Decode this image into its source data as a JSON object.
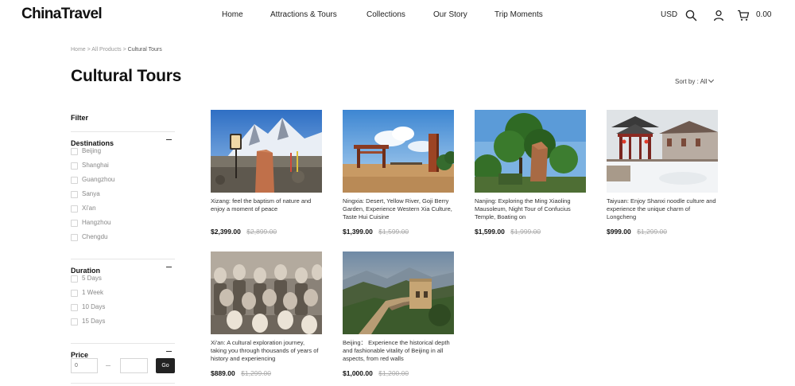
{
  "brand": {
    "logo": "ChinaTravel"
  },
  "nav": [
    {
      "label": "Home"
    },
    {
      "label": "Attractions & Tours"
    },
    {
      "label": "Collections"
    },
    {
      "label": "Our Story"
    },
    {
      "label": "Trip Moments"
    }
  ],
  "header": {
    "currency": "USD",
    "cart_total": "0.00",
    "icons": [
      "search-icon",
      "user-icon",
      "cart-icon"
    ]
  },
  "breadcrumb": {
    "home": "Home",
    "all_products": "All Products",
    "current": "Cultural Tours",
    "separator": ">"
  },
  "page": {
    "title": "Cultural Tours",
    "sort_label": "Sort by : All"
  },
  "filter": {
    "title": "Filter",
    "destinations": {
      "label": "Destinations",
      "options": [
        "Beijing",
        "Shanghai",
        "Guangzhou",
        "Sanya",
        "Xi'an",
        "Hangzhou",
        "Chengdu"
      ]
    },
    "duration": {
      "label": "Duration",
      "options": [
        "5 Days",
        "1 Week",
        "10 Days",
        "15 Days"
      ]
    },
    "price": {
      "label": "Price",
      "min_value": "0",
      "max_value": "",
      "go_label": "Go",
      "dash": "—"
    }
  },
  "products": [
    {
      "desc": "Xizang: feel the baptism of nature and enjoy a moment of peace",
      "price": "$2,399.00",
      "old_price": "$2,899.00",
      "image": "everest-stone-marker"
    },
    {
      "desc": "Ningxia: Desert, Yellow River, Goji Berry Garden, Experience Western Xia Culture, Taste Hui Cuisine",
      "price": "$1,399.00",
      "old_price": "$1,599.00",
      "image": "desert-gate"
    },
    {
      "desc": "Nanjing: Exploring the Ming Xiaoling Mausoleum, Night Tour of Confucius Temple, Boating on",
      "price": "$1,599.00",
      "old_price": "$1,999.00",
      "image": "tree-and-stone"
    },
    {
      "desc": "Taiyuan: Enjoy Shanxi noodle culture and experience the unique charm of Longcheng",
      "price": "$999.00",
      "old_price": "$1,299.00",
      "image": "snowy-pavilion"
    },
    {
      "desc": "Xi'an: A cultural exploration journey, taking you through thousands of years of history and experiencing",
      "price": "$889.00",
      "old_price": "$1,299.00",
      "image": "terracotta-warriors"
    },
    {
      "desc": "Beijing： Experience the historical depth and fashionable vitality of Beijing in all aspects, from red walls",
      "price": "$1,000.00",
      "old_price": "$1,200.00",
      "image": "great-wall"
    }
  ]
}
